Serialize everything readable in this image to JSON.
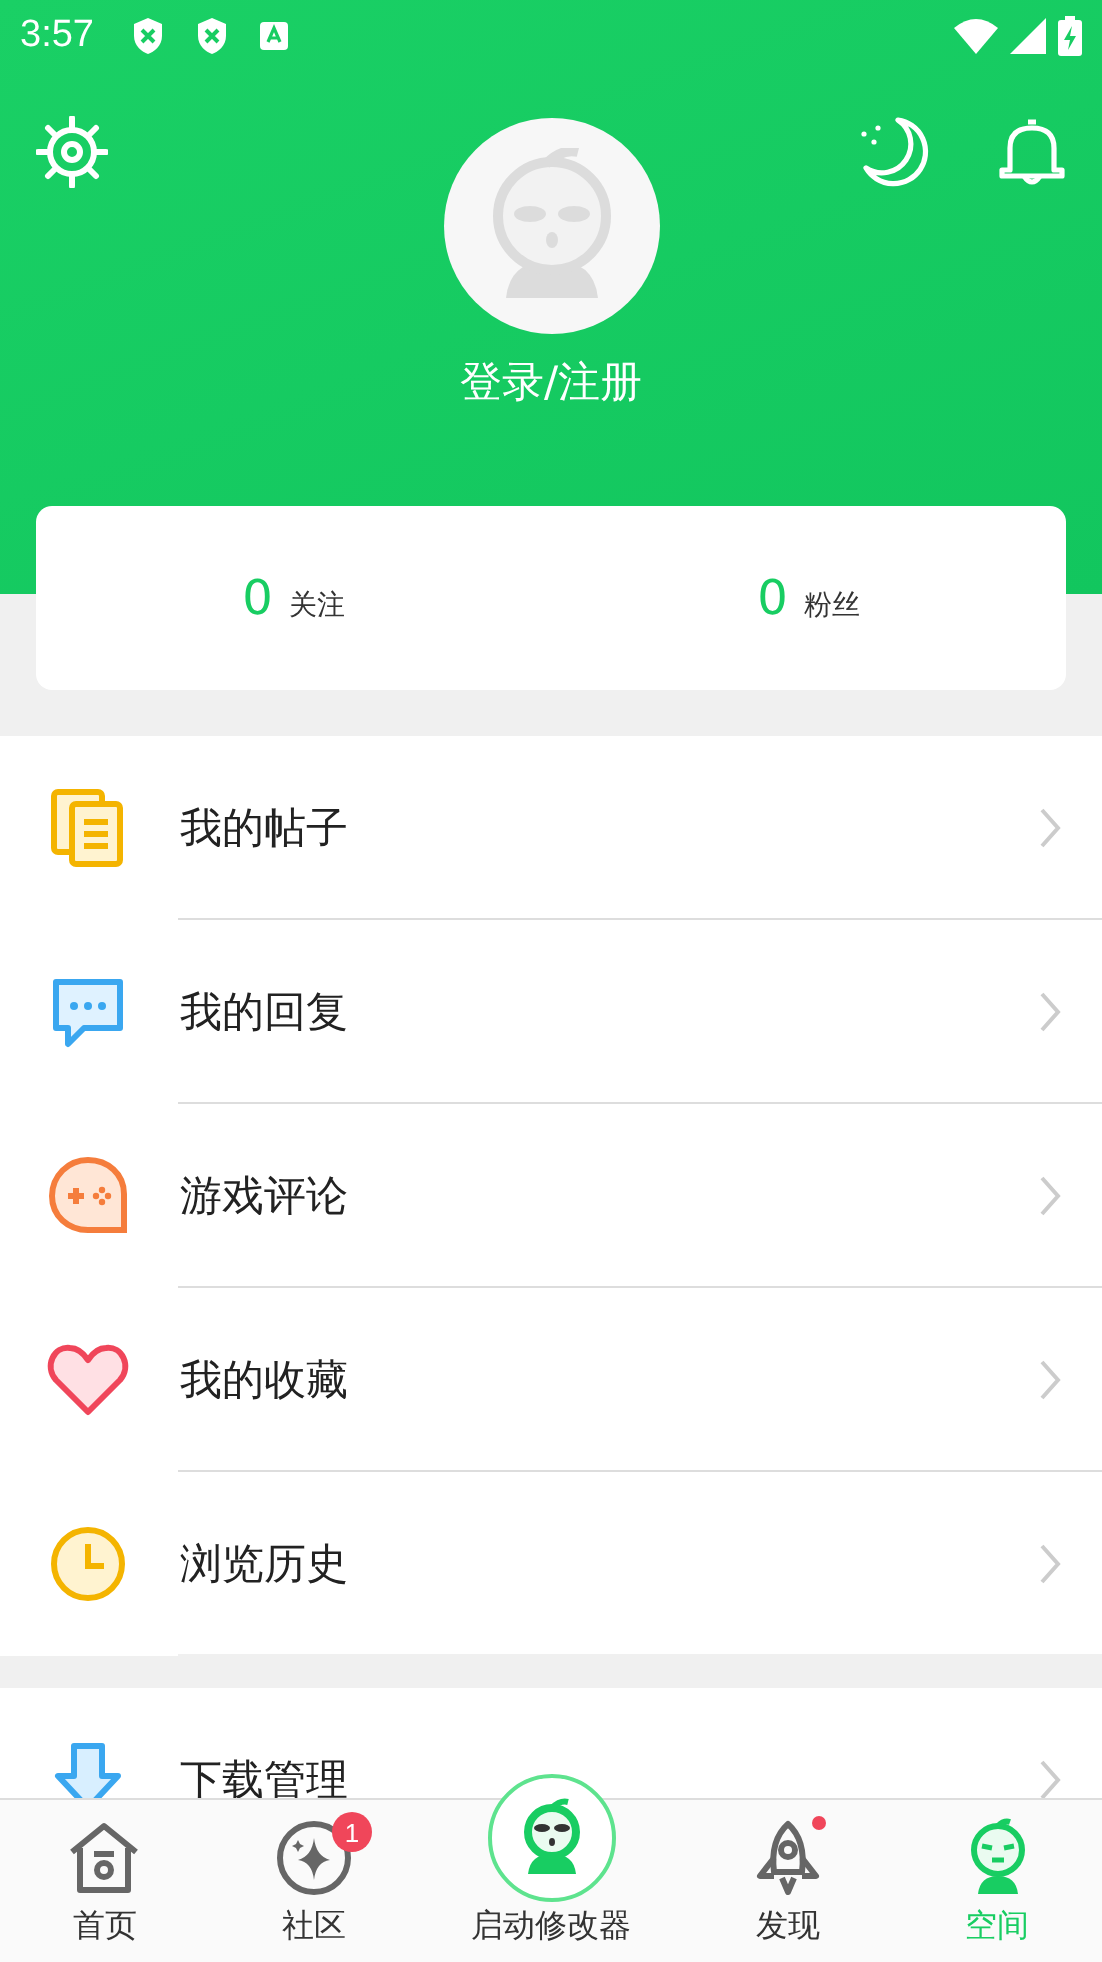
{
  "status_bar": {
    "time": "3:57"
  },
  "header": {
    "login": "登录/注册"
  },
  "stats": [
    {
      "count": "0",
      "label": "关注"
    },
    {
      "count": "0",
      "label": "粉丝"
    }
  ],
  "menu_groups": [
    [
      {
        "label": "我的帖子"
      },
      {
        "label": "我的回复"
      },
      {
        "label": "游戏评论"
      },
      {
        "label": "我的收藏"
      },
      {
        "label": "浏览历史"
      }
    ],
    [
      {
        "label": "下载管理"
      }
    ]
  ],
  "bottom_nav": [
    {
      "label": "首页",
      "kind": "tab",
      "selected": false
    },
    {
      "label": "社区",
      "kind": "tab",
      "selected": false,
      "badge": "1"
    },
    {
      "label": "启动修改器",
      "kind": "center",
      "selected": false
    },
    {
      "label": "发现",
      "kind": "tab",
      "selected": false,
      "dot": true
    },
    {
      "label": "空间",
      "kind": "tab",
      "selected": true
    }
  ]
}
